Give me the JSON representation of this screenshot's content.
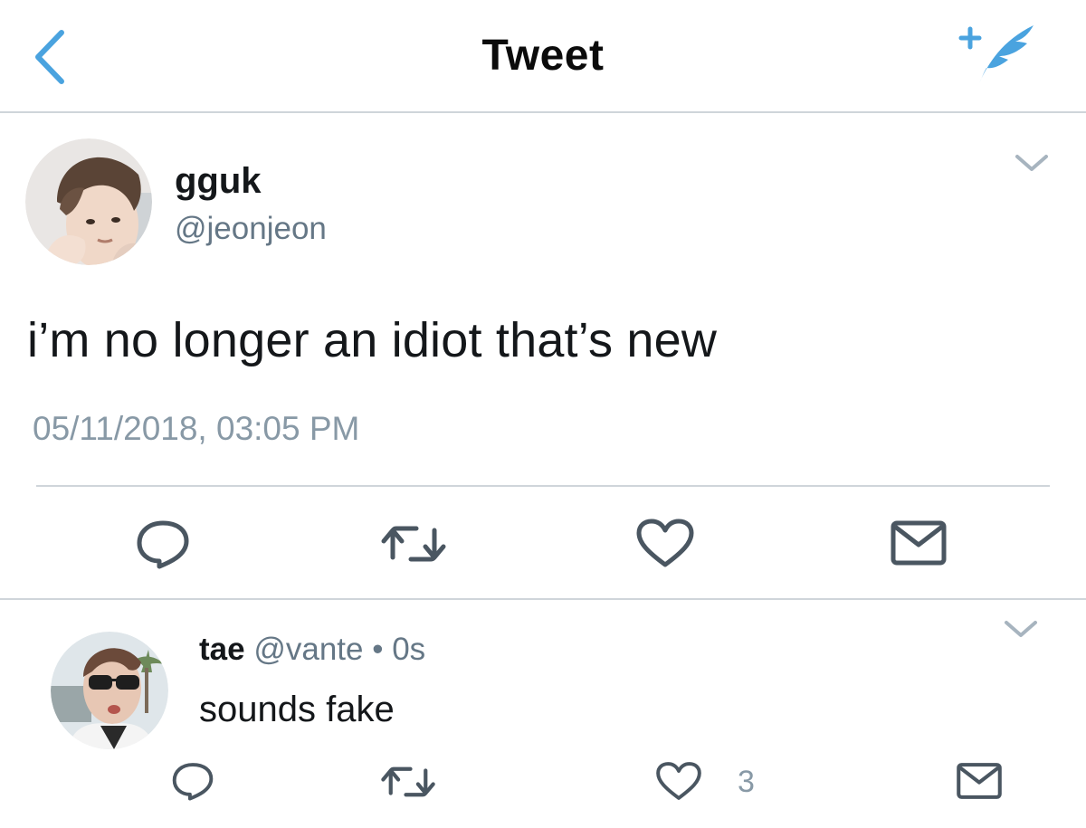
{
  "header": {
    "title": "Tweet",
    "back_icon": "chevron-left-icon",
    "compose_icon": "compose-quill-icon",
    "accent_color": "#4aa3df"
  },
  "tweet": {
    "display_name": "gguk",
    "handle": "@jeonjeon",
    "text": "i’m no longer an idiot that’s new",
    "timestamp": "05/11/2018, 03:05 PM",
    "actions": [
      "reply-icon",
      "retweet-icon",
      "like-icon",
      "message-icon"
    ]
  },
  "reply": {
    "display_name": "tae",
    "handle": "@vante",
    "separator": "•",
    "time": "0s",
    "text": "sounds fake",
    "like_count": "3",
    "actions": [
      "reply-icon",
      "retweet-icon",
      "like-icon",
      "message-icon"
    ]
  },
  "colors": {
    "icon_gray": "#657786",
    "divider": "#cfd5da",
    "secondary_text": "#8899a6"
  }
}
